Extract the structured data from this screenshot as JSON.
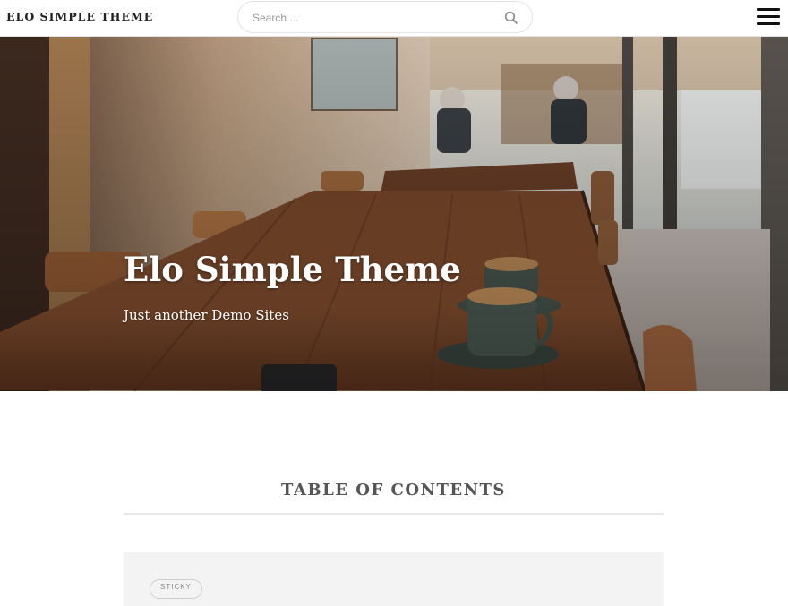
{
  "header": {
    "site_title": "ELO SIMPLE THEME",
    "search_placeholder": "Search ...",
    "search_icon": "search-icon",
    "menu_icon": "hamburger-menu-icon"
  },
  "hero": {
    "title": "Elo Simple Theme",
    "tagline": "Just another Demo Sites"
  },
  "content": {
    "section_heading": "TABLE OF CONTENTS",
    "post_badge": "STICKY"
  },
  "colors": {
    "header_bg": "#ffffff",
    "text_dark": "#222222",
    "heading_gray": "#555555",
    "card_bg": "#f3f3f3"
  }
}
